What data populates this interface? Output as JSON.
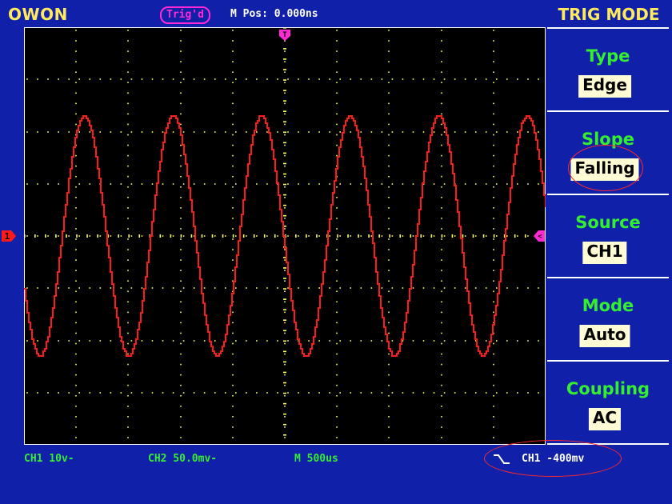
{
  "header": {
    "brand": "OWON",
    "trig_status": "Trig'd",
    "m_pos": "M Pos: 0.000ns",
    "menu_title": "TRIG MODE"
  },
  "menu": [
    {
      "label": "Type",
      "value": "Edge"
    },
    {
      "label": "Slope",
      "value": "Falling"
    },
    {
      "label": "Source",
      "value": "CH1"
    },
    {
      "label": "Mode",
      "value": "Auto"
    },
    {
      "label": "Coupling",
      "value": "AC"
    }
  ],
  "status": {
    "ch1_scale": "CH1 10v-",
    "ch2_scale": "CH2 50.0mv-",
    "timebase": "M 500us",
    "trigger_level": "CH1 -400mv"
  },
  "markers": {
    "ch1_ground": "1",
    "trigger_pos": "T",
    "trigger_level": "<"
  },
  "colors": {
    "background": "#1020a8",
    "trace": "#ff1a1a",
    "grid": "#ffff66",
    "label_green": "#34ee30",
    "highlight": "#ff2ad6"
  }
}
